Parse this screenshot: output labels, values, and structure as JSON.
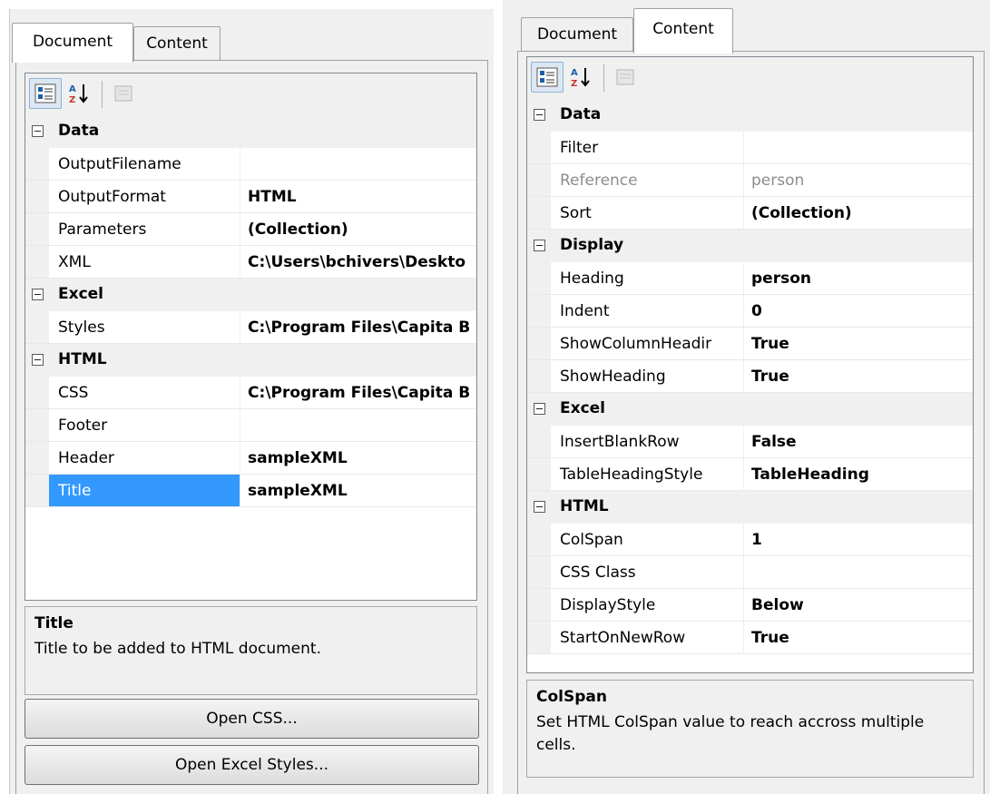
{
  "left": {
    "tabs": [
      {
        "label": "Document",
        "active": true
      },
      {
        "label": "Content",
        "active": false
      }
    ],
    "toolbar": {
      "categorized": "categorized-icon",
      "alphabetical": "sort-alphabetical-icon",
      "property_pages": "property-pages-icon"
    },
    "categories": [
      {
        "name": "Data",
        "properties": [
          {
            "name": "OutputFilename",
            "value": ""
          },
          {
            "name": "OutputFormat",
            "value": "HTML"
          },
          {
            "name": "Parameters",
            "value": "(Collection)"
          },
          {
            "name": "XML",
            "value": "C:\\Users\\bchivers\\Deskto"
          }
        ]
      },
      {
        "name": "Excel",
        "properties": [
          {
            "name": "Styles",
            "value": "C:\\Program Files\\Capita B"
          }
        ]
      },
      {
        "name": "HTML",
        "properties": [
          {
            "name": "CSS",
            "value": "C:\\Program Files\\Capita B"
          },
          {
            "name": "Footer",
            "value": ""
          },
          {
            "name": "Header",
            "value": "sampleXML"
          },
          {
            "name": "Title",
            "value": "sampleXML",
            "selected": true
          }
        ]
      }
    ],
    "description": {
      "title": "Title",
      "text": "Title to be added to HTML document."
    },
    "buttons": {
      "open_css": "Open CSS...",
      "open_excel_styles": "Open Excel Styles..."
    }
  },
  "right": {
    "tabs": [
      {
        "label": "Document",
        "active": false
      },
      {
        "label": "Content",
        "active": true
      }
    ],
    "toolbar": {
      "categorized": "categorized-icon",
      "alphabetical": "sort-alphabetical-icon",
      "property_pages": "property-pages-icon"
    },
    "categories": [
      {
        "name": "Data",
        "properties": [
          {
            "name": "Filter",
            "value": ""
          },
          {
            "name": "Reference",
            "value": "person",
            "readonly": true
          },
          {
            "name": "Sort",
            "value": "(Collection)"
          }
        ]
      },
      {
        "name": "Display",
        "properties": [
          {
            "name": "Heading",
            "value": "person"
          },
          {
            "name": "Indent",
            "value": "0"
          },
          {
            "name": "ShowColumnHeadir",
            "value": "True"
          },
          {
            "name": "ShowHeading",
            "value": "True"
          }
        ]
      },
      {
        "name": "Excel",
        "properties": [
          {
            "name": "InsertBlankRow",
            "value": "False"
          },
          {
            "name": "TableHeadingStyle",
            "value": "TableHeading"
          }
        ]
      },
      {
        "name": "HTML",
        "properties": [
          {
            "name": "ColSpan",
            "value": "1"
          },
          {
            "name": "CSS Class",
            "value": ""
          },
          {
            "name": "DisplayStyle",
            "value": "Below"
          },
          {
            "name": "StartOnNewRow",
            "value": "True"
          }
        ]
      }
    ],
    "description": {
      "title": "ColSpan",
      "text": "Set HTML ColSpan value to reach accross multiple cells."
    }
  },
  "colors": {
    "selection": "#3399ff",
    "panel": "#f0f0f0",
    "readonly_text": "#8c8c8c"
  }
}
